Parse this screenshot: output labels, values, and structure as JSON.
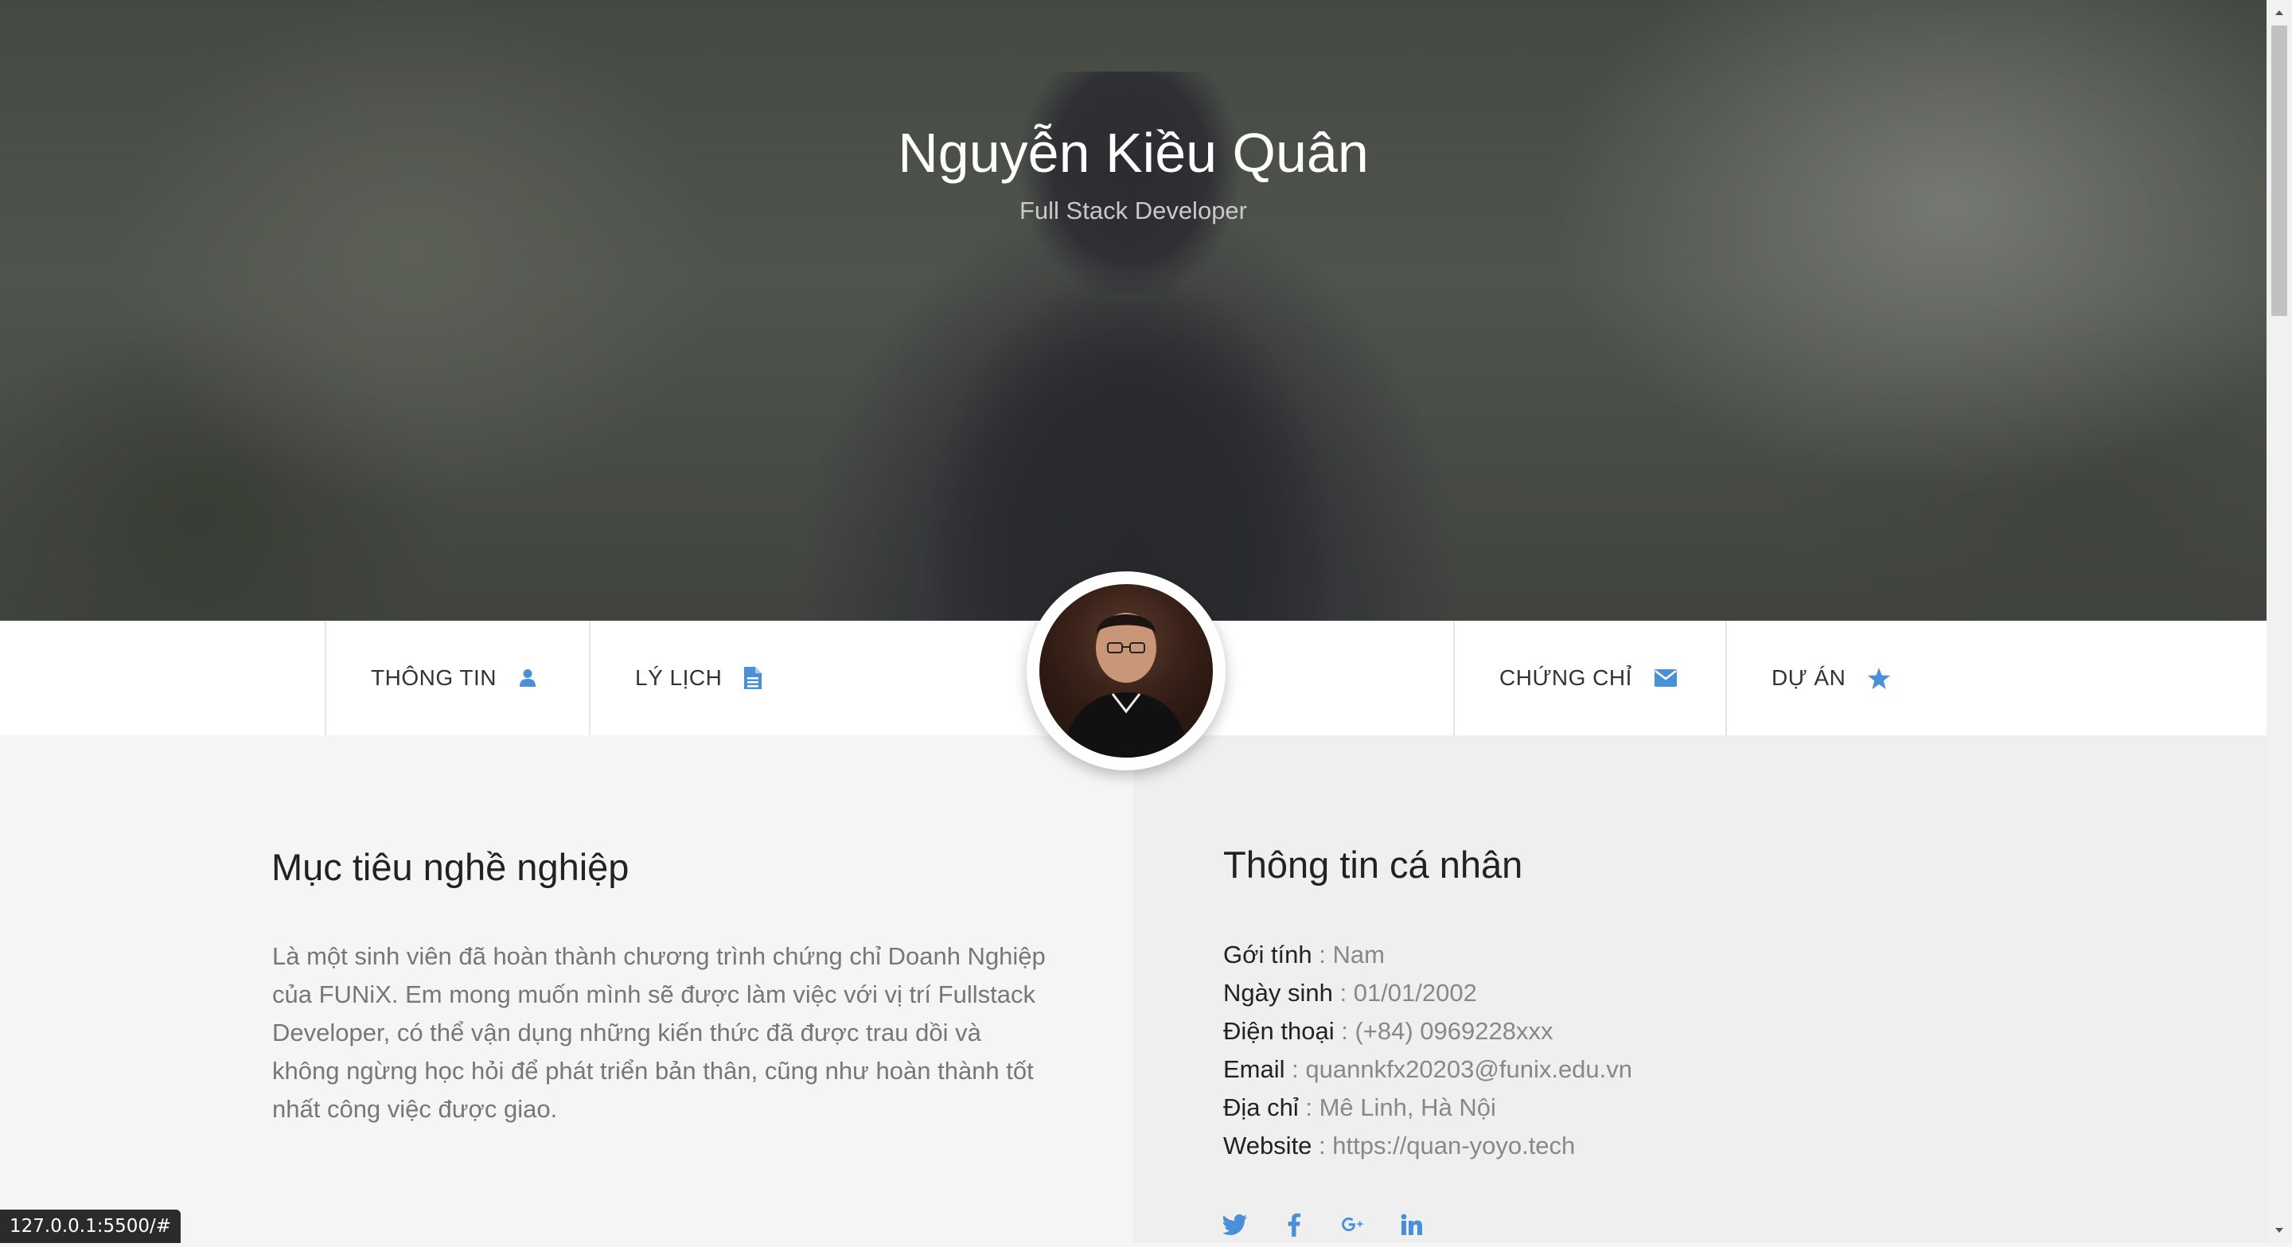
{
  "hero": {
    "title": "Nguyễn Kiều Quân",
    "subtitle": "Full Stack Developer"
  },
  "nav": {
    "items": [
      {
        "label": "THÔNG TIN",
        "icon": "user-icon"
      },
      {
        "label": "LÝ LỊCH",
        "icon": "file-icon"
      },
      {
        "label": "CHỨNG CHỈ",
        "icon": "envelope-icon"
      },
      {
        "label": "DỰ ÁN",
        "icon": "star-icon"
      }
    ],
    "accent_color": "#4a90d9"
  },
  "objective": {
    "title": "Mục tiêu nghề nghiệp",
    "text": "Là một sinh viên đã hoàn thành chương trình chứng chỉ Doanh Nghiệp của FUNiX. Em mong muốn mình sẽ được làm việc với vị trí Fullstack Developer, có thể vận dụng những kiến thức đã được trau dồi và không ngừng học hỏi để phát triển bản thân, cũng như hoàn thành tốt nhất công việc được giao."
  },
  "personal": {
    "title": "Thông tin cá nhân",
    "rows": [
      {
        "label": "Gới tính",
        "sep": " : ",
        "value": "Nam"
      },
      {
        "label": "Ngày sinh",
        "sep": " : ",
        "value": "01/01/2002"
      },
      {
        "label": "Điện thoại",
        "sep": " : ",
        "value": "(+84) 0969228xxx"
      },
      {
        "label": "Email",
        "sep": " : ",
        "value": "quannkfx20203@funix.edu.vn"
      },
      {
        "label": "Địa chỉ",
        "sep": " : ",
        "value": "Mê Linh, Hà Nội"
      },
      {
        "label": "Website",
        "sep": " : ",
        "value": "https://quan-yoyo.tech"
      }
    ],
    "social": [
      "twitter-icon",
      "facebook-icon",
      "google-plus-icon",
      "linkedin-icon"
    ]
  },
  "status": {
    "url": "127.0.0.1:5500/#"
  }
}
